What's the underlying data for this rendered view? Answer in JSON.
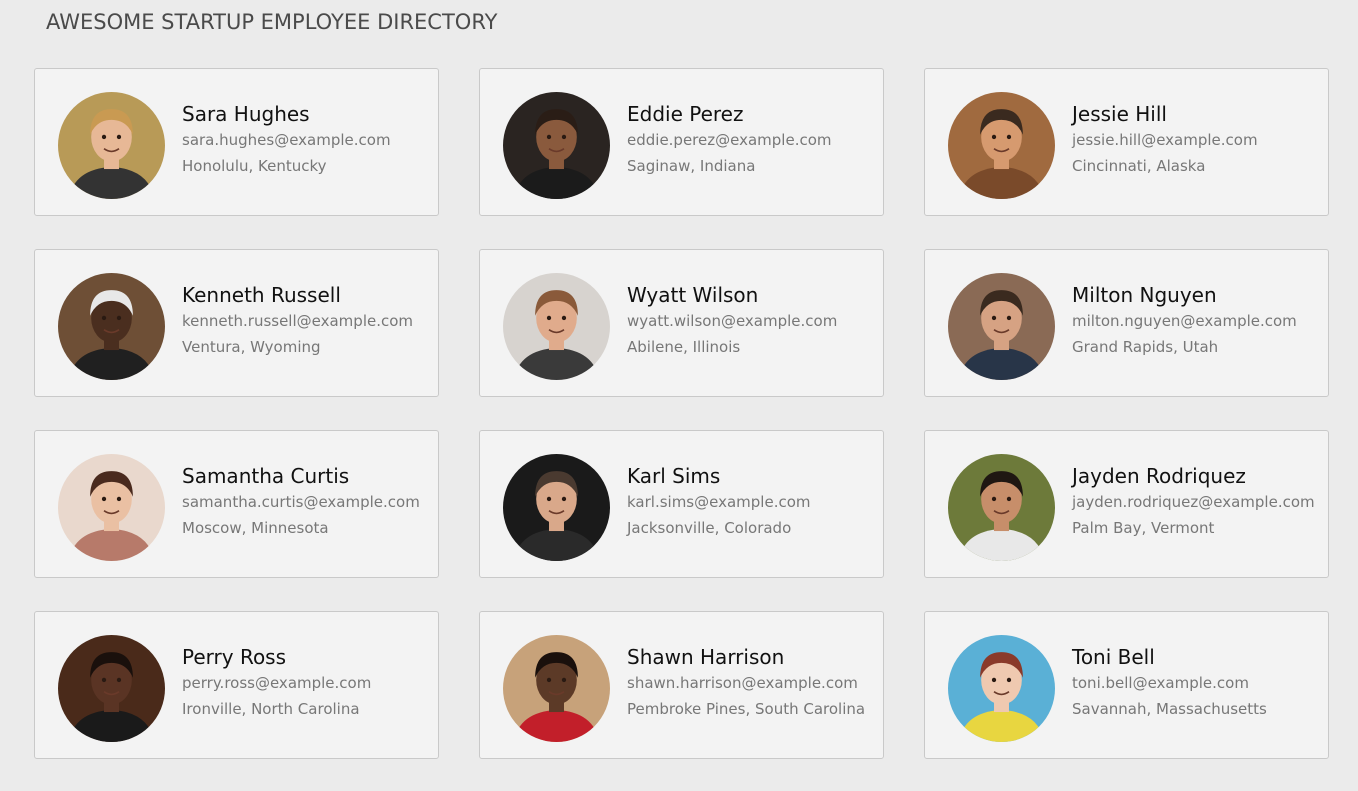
{
  "header": {
    "title": "AWESOME STARTUP EMPLOYEE DIRECTORY"
  },
  "employees": [
    {
      "name": "Sara Hughes",
      "email": "sara.hughes@example.com",
      "location": "Honolulu, Kentucky",
      "avatar": {
        "bg": "#b89a57",
        "skin": "#e7b896",
        "hair": "#c99a52",
        "shirt": "#333333"
      }
    },
    {
      "name": "Eddie Perez",
      "email": "eddie.perez@example.com",
      "location": "Saginaw, Indiana",
      "avatar": {
        "bg": "#2a2421",
        "skin": "#8a5a3d",
        "hair": "#2a1d16",
        "shirt": "#1b1b1b"
      }
    },
    {
      "name": "Jessie Hill",
      "email": "jessie.hill@example.com",
      "location": "Cincinnati, Alaska",
      "avatar": {
        "bg": "#a06a3f",
        "skin": "#d69a6f",
        "hair": "#3a2a1f",
        "shirt": "#7a4a2a"
      }
    },
    {
      "name": "Kenneth Russell",
      "email": "kenneth.russell@example.com",
      "location": "Ventura, Wyoming",
      "avatar": {
        "bg": "#6e4f36",
        "skin": "#4a2e1f",
        "hair": "#e8e8e8",
        "shirt": "#202020"
      }
    },
    {
      "name": "Wyatt Wilson",
      "email": "wyatt.wilson@example.com",
      "location": "Abilene, Illinois",
      "avatar": {
        "bg": "#d7d3cf",
        "skin": "#e0ab8c",
        "hair": "#8a5a3a",
        "shirt": "#3a3a3a"
      }
    },
    {
      "name": "Milton Nguyen",
      "email": "milton.nguyen@example.com",
      "location": "Grand Rapids, Utah",
      "avatar": {
        "bg": "#8a6a55",
        "skin": "#d6a283",
        "hair": "#3a2a1f",
        "shirt": "#283548"
      }
    },
    {
      "name": "Samantha Curtis",
      "email": "samantha.curtis@example.com",
      "location": "Moscow, Minnesota",
      "avatar": {
        "bg": "#e9d8cd",
        "skin": "#eac0a3",
        "hair": "#4a2a1e",
        "shirt": "#b77a6a"
      }
    },
    {
      "name": "Karl Sims",
      "email": "karl.sims@example.com",
      "location": "Jacksonville, Colorado",
      "avatar": {
        "bg": "#1a1a1a",
        "skin": "#d9a88a",
        "hair": "#4a3a30",
        "shirt": "#2a2a2a"
      }
    },
    {
      "name": "Jayden Rodriquez",
      "email": "jayden.rodriquez@example.com",
      "location": "Palm Bay, Vermont",
      "avatar": {
        "bg": "#6d7a3a",
        "skin": "#c78e6a",
        "hair": "#1f1712",
        "shirt": "#e8e8e8"
      }
    },
    {
      "name": "Perry Ross",
      "email": "perry.ross@example.com",
      "location": "Ironville, North Carolina",
      "avatar": {
        "bg": "#4a2a1a",
        "skin": "#5a3424",
        "hair": "#1a100c",
        "shirt": "#1a1a1a"
      }
    },
    {
      "name": "Shawn Harrison",
      "email": "shawn.harrison@example.com",
      "location": "Pembroke Pines, South Carolina",
      "avatar": {
        "bg": "#c7a27a",
        "skin": "#5c3a27",
        "hair": "#1a100c",
        "shirt": "#c21f2a"
      }
    },
    {
      "name": "Toni Bell",
      "email": "toni.bell@example.com",
      "location": "Savannah, Massachusetts",
      "avatar": {
        "bg": "#5ab0d6",
        "skin": "#efc9b0",
        "hair": "#8a3a2a",
        "shirt": "#e8d640"
      }
    }
  ]
}
